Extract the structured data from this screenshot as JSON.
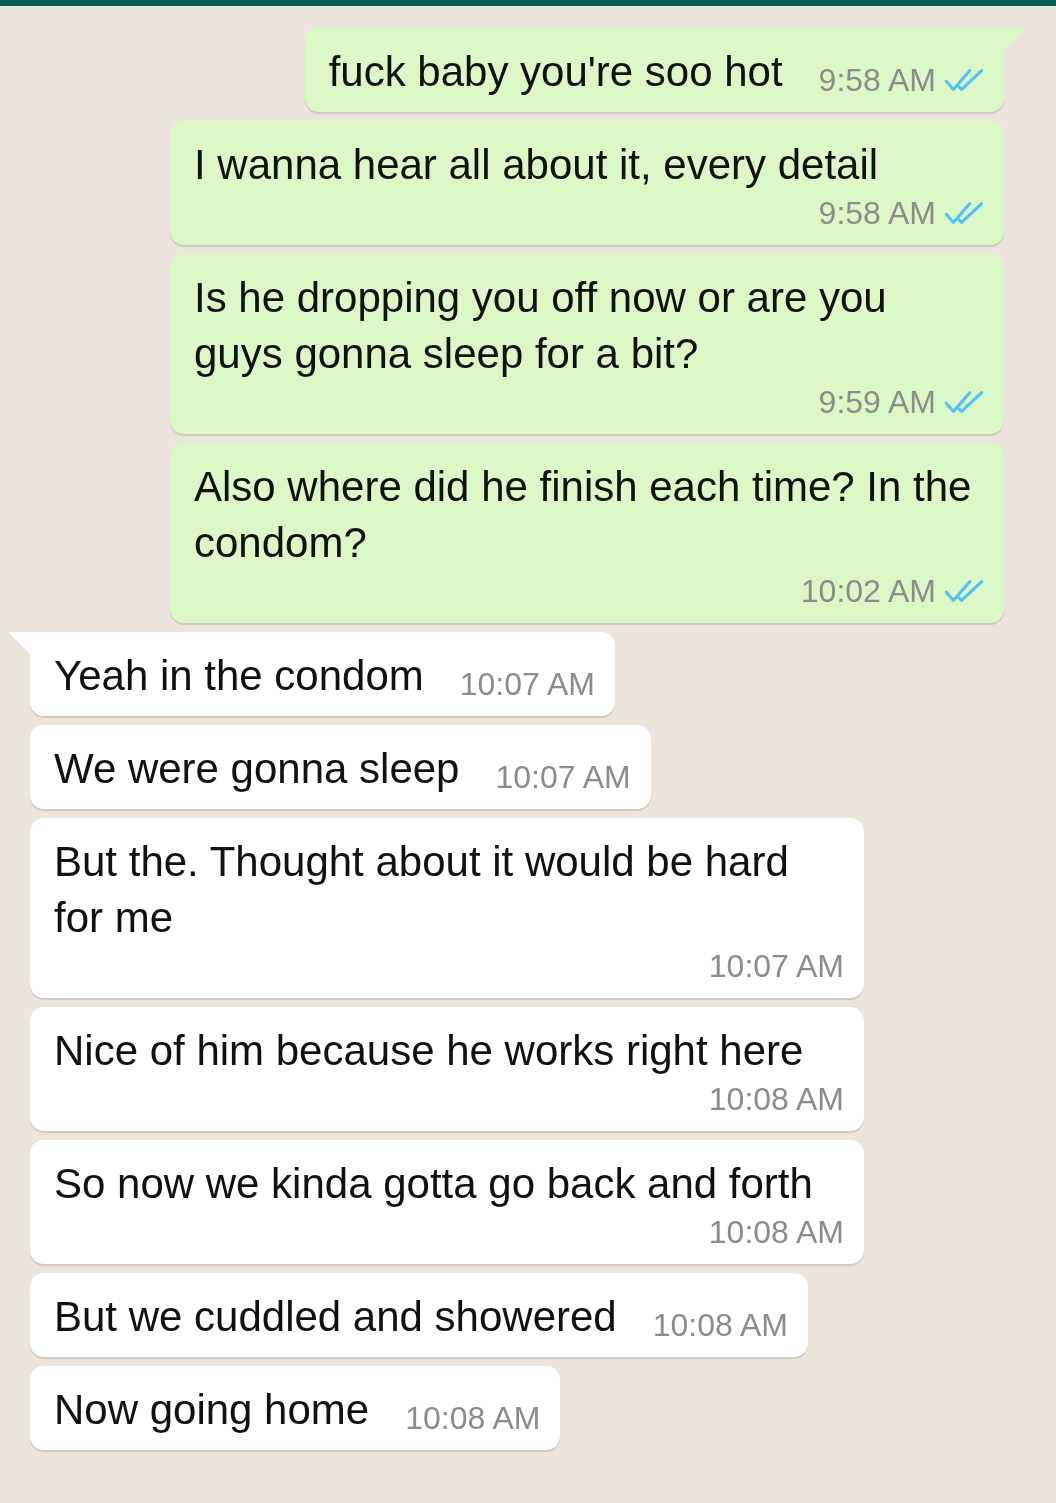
{
  "messages": [
    {
      "kind": "outgoing",
      "tail": true,
      "text": "fuck baby you're soo hot",
      "time": "9:58 AM",
      "read": true
    },
    {
      "kind": "outgoing",
      "tail": false,
      "text": "I wanna hear all about it, every detail",
      "time": "9:58 AM",
      "read": true
    },
    {
      "kind": "outgoing",
      "tail": false,
      "text": "Is he dropping you off now or are you guys gonna sleep for a bit?",
      "time": "9:59 AM",
      "read": true
    },
    {
      "kind": "outgoing",
      "tail": false,
      "text": "Also where did he finish each time? In the condom?",
      "time": "10:02 AM",
      "read": true
    },
    {
      "kind": "incoming",
      "tail": true,
      "text": "Yeah in the condom",
      "time": "10:07 AM"
    },
    {
      "kind": "incoming",
      "tail": false,
      "text": "We were gonna sleep",
      "time": "10:07 AM"
    },
    {
      "kind": "incoming",
      "tail": false,
      "text": "But the. Thought about it would be hard for me",
      "time": "10:07 AM"
    },
    {
      "kind": "incoming",
      "tail": false,
      "text": "Nice of him because he works right here",
      "time": "10:08 AM"
    },
    {
      "kind": "incoming",
      "tail": false,
      "text": "So now we kinda gotta go back and forth",
      "time": "10:08 AM"
    },
    {
      "kind": "incoming",
      "tail": false,
      "text": "But we cuddled and showered",
      "time": "10:08 AM"
    },
    {
      "kind": "incoming",
      "tail": false,
      "text": "Now going home",
      "time": "10:08 AM"
    }
  ]
}
